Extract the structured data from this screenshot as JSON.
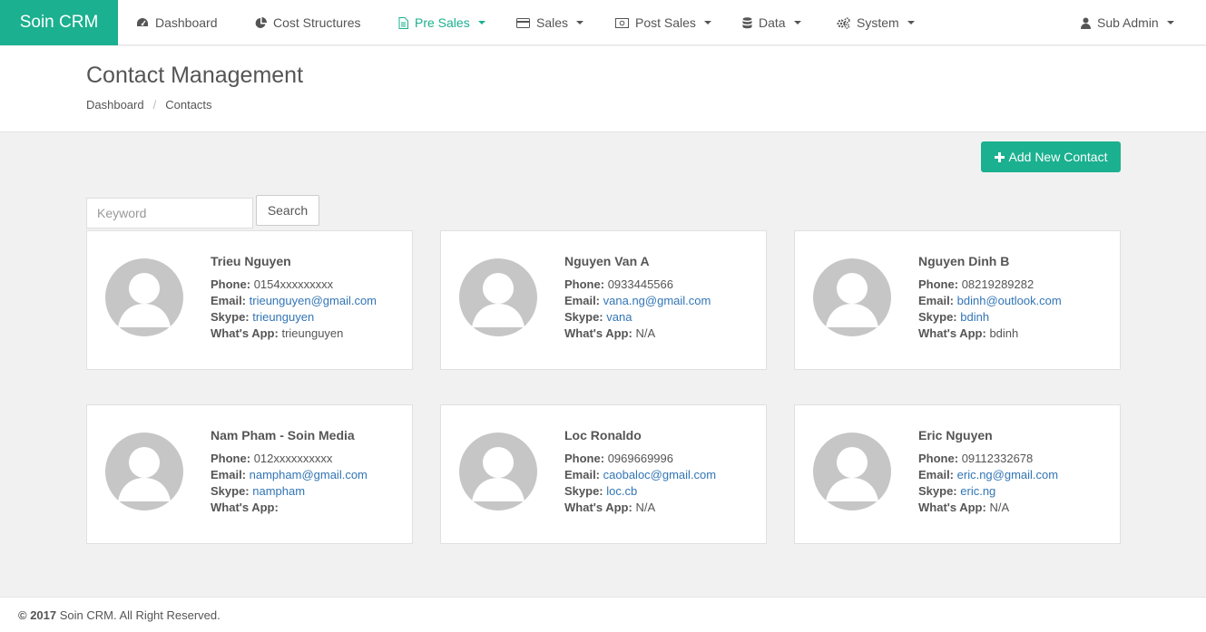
{
  "brand": "Soin CRM",
  "nav": {
    "dashboard": "Dashboard",
    "cost_structures": "Cost Structures",
    "pre_sales": "Pre Sales",
    "sales": "Sales",
    "post_sales": "Post Sales",
    "data": "Data",
    "system": "System",
    "user": "Sub Admin"
  },
  "header": {
    "title": "Contact Management",
    "breadcrumb": [
      "Dashboard",
      "Contacts"
    ]
  },
  "toolbar": {
    "add_label": "Add New Contact"
  },
  "search": {
    "placeholder": "Keyword",
    "button": "Search"
  },
  "labels": {
    "phone": "Phone:",
    "email": "Email:",
    "skype": "Skype:",
    "whatsapp": "What's App:"
  },
  "contacts": [
    {
      "name": "Trieu Nguyen",
      "phone": "0154xxxxxxxxx",
      "email": "trieunguyen@gmail.com",
      "skype": "trieunguyen",
      "whatsapp": "trieunguyen"
    },
    {
      "name": "Nguyen Van A",
      "phone": "0933445566",
      "email": "vana.ng@gmail.com",
      "skype": "vana",
      "whatsapp": "N/A"
    },
    {
      "name": "Nguyen Dinh B",
      "phone": "08219289282",
      "email": "bdinh@outlook.com",
      "skype": "bdinh",
      "whatsapp": "bdinh"
    },
    {
      "name": "Nam Pham - Soin Media",
      "phone": "012xxxxxxxxxx",
      "email": "nampham@gmail.com",
      "skype": "nampham",
      "whatsapp": ""
    },
    {
      "name": "Loc Ronaldo",
      "phone": "0969669996",
      "email": "caobaloc@gmail.com",
      "skype": "loc.cb",
      "whatsapp": "N/A"
    },
    {
      "name": "Eric Nguyen",
      "phone": "09112332678",
      "email": "eric.ng@gmail.com",
      "skype": "eric.ng",
      "whatsapp": "N/A"
    }
  ],
  "footer": {
    "year": "© 2017",
    "text": " Soin CRM. All Right Reserved."
  },
  "colors": {
    "accent": "#1bb08f",
    "link": "#3275b5",
    "avatar": "#c6c6c6"
  }
}
